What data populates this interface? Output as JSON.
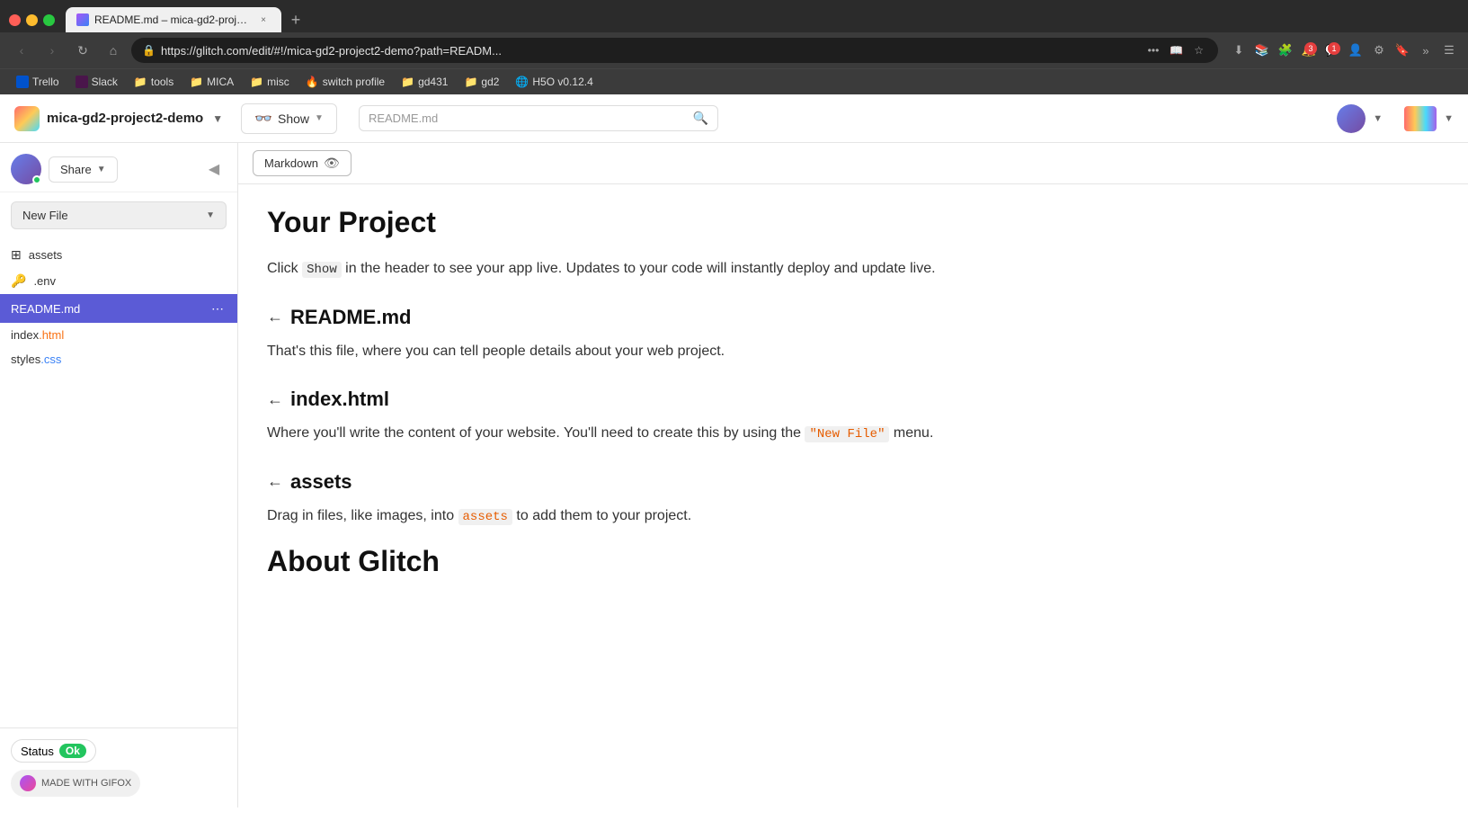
{
  "browser": {
    "traffic_lights": [
      "red",
      "yellow",
      "green"
    ],
    "tab": {
      "title": "README.md – mica-gd2-projec...",
      "close_label": "×"
    },
    "new_tab_label": "+",
    "nav": {
      "back_label": "‹",
      "forward_label": "›",
      "reload_label": "↻",
      "home_label": "⌂",
      "url": "https://glitch.com/edit/#!/mica-gd2-project2-demo?path=READM...",
      "more_label": "•••",
      "bookmark_label": "☆"
    },
    "bookmarks": [
      {
        "label": "Trello",
        "type": "trello"
      },
      {
        "label": "Slack",
        "type": "slack"
      },
      {
        "label": "tools",
        "type": "folder"
      },
      {
        "label": "MICA",
        "type": "folder"
      },
      {
        "label": "misc",
        "type": "folder"
      },
      {
        "label": "switch profile",
        "type": "special"
      },
      {
        "label": "gd431",
        "type": "folder"
      },
      {
        "label": "gd2",
        "type": "folder"
      },
      {
        "label": "H5O v0.12.4",
        "type": "special"
      }
    ]
  },
  "glitch": {
    "header": {
      "project_name": "mica-gd2-project2-demo",
      "show_label": "Show",
      "file_placeholder": "README.md",
      "search_icon": "🔍"
    },
    "sidebar": {
      "share_label": "Share",
      "new_file_label": "New File",
      "files": [
        {
          "name": "assets",
          "icon": "grid",
          "type": "folder"
        },
        {
          "name": ".env",
          "icon": "key",
          "type": "env"
        },
        {
          "name": "README.md",
          "icon": "",
          "type": "md",
          "active": true
        },
        {
          "name": "index.html",
          "icon": "",
          "type": "html"
        },
        {
          "name": "styles.css",
          "icon": "",
          "type": "css"
        }
      ],
      "status_label": "Status",
      "status_value": "Ok",
      "made_with": "MADE WITH GIFOX"
    },
    "editor": {
      "toolbar": {
        "markdown_label": "Markdown"
      },
      "content": {
        "h1": "Your Project",
        "p1": "Click Show in the header to see your app live. Updates to your code will instantly deploy and update live.",
        "h2_readme": "README.md",
        "p_readme": "That's this file, where you can tell people details about your web project.",
        "h2_index": "index.html",
        "p_index_1": "Where you'll write the content of your website. You'll need to create this by using the",
        "p_index_code": "\"New File\"",
        "p_index_2": "menu.",
        "h2_assets": "assets",
        "p_assets_1": "Drag in files, like images, into",
        "p_assets_code": "assets",
        "p_assets_2": "to add them to your project.",
        "h1_about": "About Glitch"
      }
    }
  }
}
